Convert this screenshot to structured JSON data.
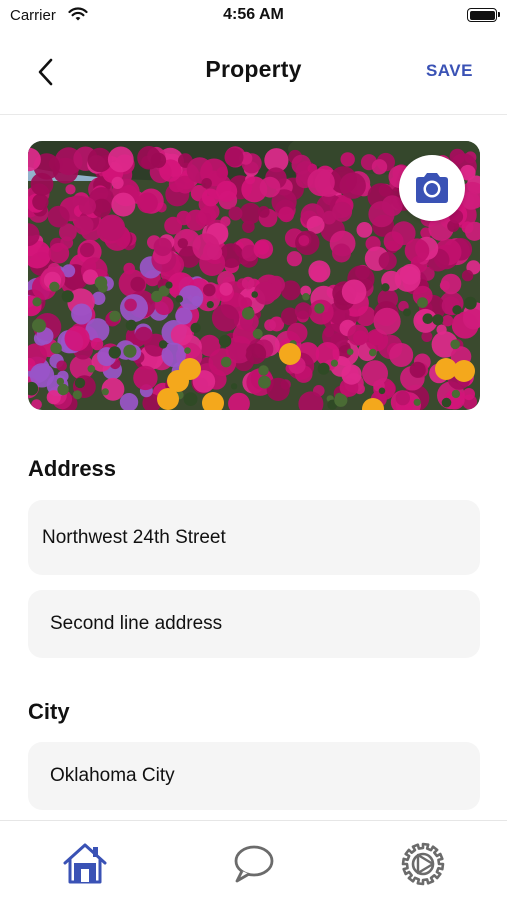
{
  "status_bar": {
    "carrier": "Carrier",
    "time": "4:56 AM"
  },
  "nav": {
    "title": "Property",
    "save_label": "SAVE",
    "back_icon": "chevron-left-icon"
  },
  "photo": {
    "description_icon": "camera-icon"
  },
  "address": {
    "label": "Address",
    "line1_value": "Northwest 24th Street",
    "line2_placeholder": "Second line address"
  },
  "city": {
    "label": "City",
    "value": "Oklahoma City"
  },
  "tabs": [
    {
      "icon": "home-icon",
      "active": true
    },
    {
      "icon": "chat-bubble-icon",
      "active": false
    },
    {
      "icon": "settings-icon",
      "active": false
    }
  ],
  "colors": {
    "accent": "#3a52b5",
    "field_bg": "#f5f5f5",
    "inactive_icon": "#6b6b6b"
  }
}
